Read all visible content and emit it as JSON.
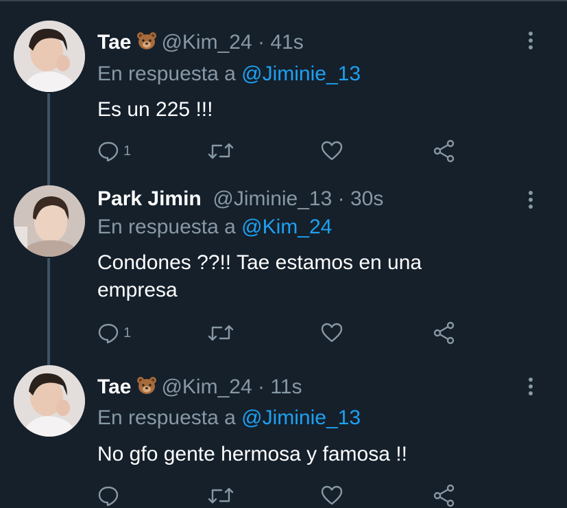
{
  "tweets": [
    {
      "name": "Tae",
      "handle": "@Kim_24",
      "separator": "·",
      "time": "41s",
      "replying_prefix": "En respuesta a",
      "replying_to": "@Jiminie_13",
      "text": "Es un 225 !!!",
      "reply_count": "1",
      "avatar": "avatar-tae"
    },
    {
      "name": "Park Jimin",
      "handle": "@Jiminie_13",
      "separator": "·",
      "time": "30s",
      "replying_prefix": "En respuesta a",
      "replying_to": "@Kim_24",
      "text": "Condones ??!! Tae estamos en una empresa",
      "reply_count": "1",
      "avatar": "avatar-jimin"
    },
    {
      "name": "Tae",
      "handle": "@Kim_24",
      "separator": "·",
      "time": "11s",
      "replying_prefix": "En respuesta a",
      "replying_to": "@Jiminie_13",
      "text": "No gfo gente hermosa y famosa !!",
      "reply_count": "",
      "avatar": "avatar-tae"
    }
  ],
  "icons": {
    "name_emoji": "bear-face-icon",
    "reply": "reply-icon",
    "retweet": "retweet-icon",
    "like": "like-icon",
    "share": "share-icon",
    "more": "more-options-icon"
  },
  "colors": {
    "background": "#15202b",
    "primary_text": "#ffffff",
    "secondary_text": "#8899a6",
    "link": "#1da1f2",
    "thread_line": "#3d5466"
  }
}
